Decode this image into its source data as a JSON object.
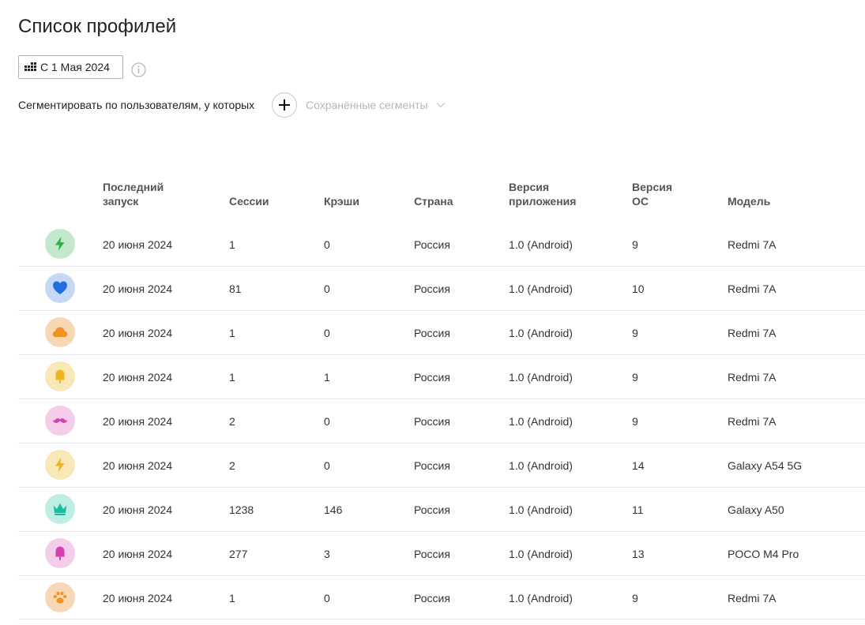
{
  "page": {
    "title": "Список профилей"
  },
  "filters": {
    "date_label": "С 1 Мая 2024",
    "segment_label": "Сегментировать по пользователям, у которых",
    "saved_segments_label": "Сохранённые сегменты"
  },
  "table": {
    "headers": {
      "last_launch_line1": "Последний",
      "last_launch_line2": "запуск",
      "sessions": "Сессии",
      "crashes": "Крэши",
      "country": "Страна",
      "app_version_line1": "Версия",
      "app_version_line2": "приложения",
      "os_version_line1": "Версия",
      "os_version_line2": "ОС",
      "model": "Модель"
    },
    "rows": [
      {
        "icon": "lightning-icon",
        "bg": "#c4e8cc",
        "fg": "#2bb24c",
        "last_launch": "20 июня 2024",
        "sessions": "1",
        "crashes": "0",
        "country": "Россия",
        "app_version": "1.0 (Android)",
        "os_version": "9",
        "model": "Redmi 7A"
      },
      {
        "icon": "heart-icon",
        "bg": "#c5d9f5",
        "fg": "#1f6fe0",
        "last_launch": "20 июня 2024",
        "sessions": "81",
        "crashes": "0",
        "country": "Россия",
        "app_version": "1.0 (Android)",
        "os_version": "10",
        "model": "Redmi 7A"
      },
      {
        "icon": "cloud-icon",
        "bg": "#f8d8b4",
        "fg": "#ee9322",
        "last_launch": "20 июня 2024",
        "sessions": "1",
        "crashes": "0",
        "country": "Россия",
        "app_version": "1.0 (Android)",
        "os_version": "9",
        "model": "Redmi 7A"
      },
      {
        "icon": "popsicle-icon",
        "bg": "#f8e8b8",
        "fg": "#eeb41f",
        "last_launch": "20 июня 2024",
        "sessions": "1",
        "crashes": "1",
        "country": "Россия",
        "app_version": "1.0 (Android)",
        "os_version": "9",
        "model": "Redmi 7A"
      },
      {
        "icon": "mustache-icon",
        "bg": "#f3cde9",
        "fg": "#d53fae",
        "last_launch": "20 июня 2024",
        "sessions": "2",
        "crashes": "0",
        "country": "Россия",
        "app_version": "1.0 (Android)",
        "os_version": "9",
        "model": "Redmi 7A"
      },
      {
        "icon": "lightning-icon",
        "bg": "#f8e8b8",
        "fg": "#eeb41f",
        "last_launch": "20 июня 2024",
        "sessions": "2",
        "crashes": "0",
        "country": "Россия",
        "app_version": "1.0 (Android)",
        "os_version": "14",
        "model": "Galaxy A54 5G"
      },
      {
        "icon": "crown-icon",
        "bg": "#bdeee3",
        "fg": "#17bfa0",
        "last_launch": "20 июня 2024",
        "sessions": "1238",
        "crashes": "146",
        "country": "Россия",
        "app_version": "1.0 (Android)",
        "os_version": "11",
        "model": "Galaxy A50"
      },
      {
        "icon": "popsicle-icon",
        "bg": "#f3cde9",
        "fg": "#d53fae",
        "last_launch": "20 июня 2024",
        "sessions": "277",
        "crashes": "3",
        "country": "Россия",
        "app_version": "1.0 (Android)",
        "os_version": "13",
        "model": "POCO M4 Pro"
      },
      {
        "icon": "paw-icon",
        "bg": "#f8d8b4",
        "fg": "#ee9322",
        "last_launch": "20 июня 2024",
        "sessions": "1",
        "crashes": "0",
        "country": "Россия",
        "app_version": "1.0 (Android)",
        "os_version": "9",
        "model": "Redmi 7A"
      }
    ]
  }
}
